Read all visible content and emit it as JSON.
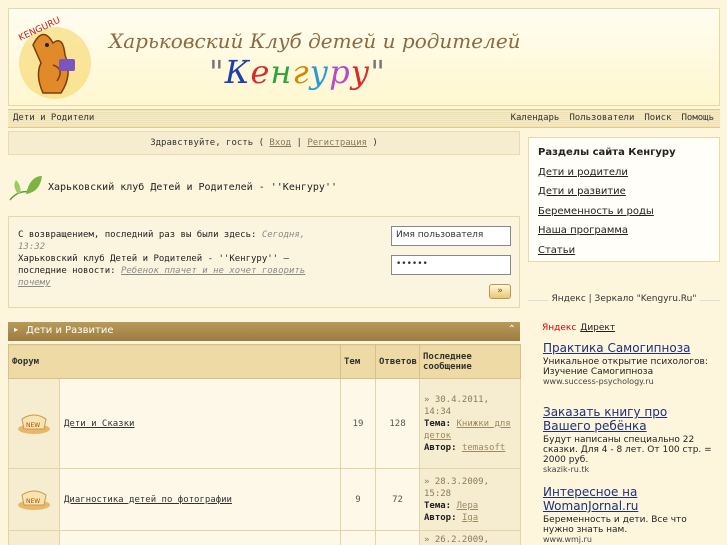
{
  "header": {
    "title_line1": "Харьковский Клуб детей и родителей",
    "title_line2_quote_open": "\"",
    "title_line2_letters": [
      "К",
      "е",
      "н",
      "г",
      "у",
      "р",
      "у"
    ],
    "title_line2_colors": [
      "#1d3fb0",
      "#d62b2b",
      "#2aa53a",
      "#d08a00",
      "#2a9ad6",
      "#b54ec4",
      "#d62b2b"
    ],
    "title_line2_quote_close": "\"",
    "logo_text": "KENGURU"
  },
  "navbar": {
    "home": "Дети и Родители",
    "links": [
      "Календарь",
      "Пользователи",
      "Поиск",
      "Помощь"
    ]
  },
  "greeting": {
    "text": "Здравствуйте, гость",
    "paren_open": "(",
    "login": "Вход",
    "sep": "|",
    "register": "Регистрация",
    "paren_close": ")"
  },
  "forum_title": "Харьковский клуб Детей и Родителей - ''Кенгуру''",
  "login_box": {
    "welcome": "С возвращением, последний раз вы были здесь:",
    "last_visit": "Сегодня, 13:32",
    "news_prefix": "Харьковский клуб Детей и Родителей - ''Кенгуру'' — последние новости:",
    "news_link": "Ребенок плачет и не хочет говорить почему",
    "username_value": "Имя пользователя",
    "password_value": "••••••",
    "submit": "»"
  },
  "category": {
    "title": "Дети и Развитие",
    "collapse": "⌃"
  },
  "table": {
    "headers": [
      "Форум",
      "Тем",
      "Ответов",
      "Последнее сообщение"
    ],
    "rows": [
      {
        "name": "Дети и Сказки",
        "topics": "19",
        "replies": "128",
        "date": "» 30.4.2011, 14:34",
        "theme_label": "Тема:",
        "theme": "Книжки для деток",
        "author_label": "Автор:",
        "author": "temasoft"
      },
      {
        "name": "Диагностика детей по фотографии",
        "topics": "9",
        "replies": "72",
        "date": "» 28.3.2009, 15:28",
        "theme_label": "Тема:",
        "theme": "Лера",
        "author_label": "Автор:",
        "author": "Iga"
      },
      {
        "name": "",
        "topics": "",
        "replies": "",
        "date": "» 26.2.2009,",
        "theme_label": "",
        "theme": "",
        "author_label": "",
        "author": ""
      }
    ],
    "new_badge": "NEW"
  },
  "sidebar": {
    "sections_title": "Разделы сайта Кенгуру",
    "sections": [
      "Дети и родители",
      "Дети и развитие",
      "Беременность и роды",
      "Наша программа",
      "Статьи"
    ]
  },
  "yandex": {
    "caption": "Яндекс | Зеркало \"Kengyru.Ru\"",
    "brand": "Яндекс",
    "direct": "Директ",
    "ads": [
      {
        "title": "Практика Самогипноза",
        "desc": "Уникальное открытие психологов: Изучение Самогипноза",
        "url": "www.success-psychology.ru"
      },
      {
        "title": "Заказать книгу про Вашего ребёнка",
        "desc": "Будут написаны специально 22 сказки. Для 4 - 8 лет. От 100 стр. = 2000 руб.",
        "url": "skazik-ru.tk"
      },
      {
        "title": "Интересное на WomanJornal.ru",
        "desc": "Беременность и дети. Все что нужно знать нам.",
        "url": "www.wmj.ru"
      }
    ]
  },
  "colors": {
    "accent_brown": "#9c7d3f",
    "bg": "#fdf6dd",
    "link_blue": "#1f2f7a"
  }
}
